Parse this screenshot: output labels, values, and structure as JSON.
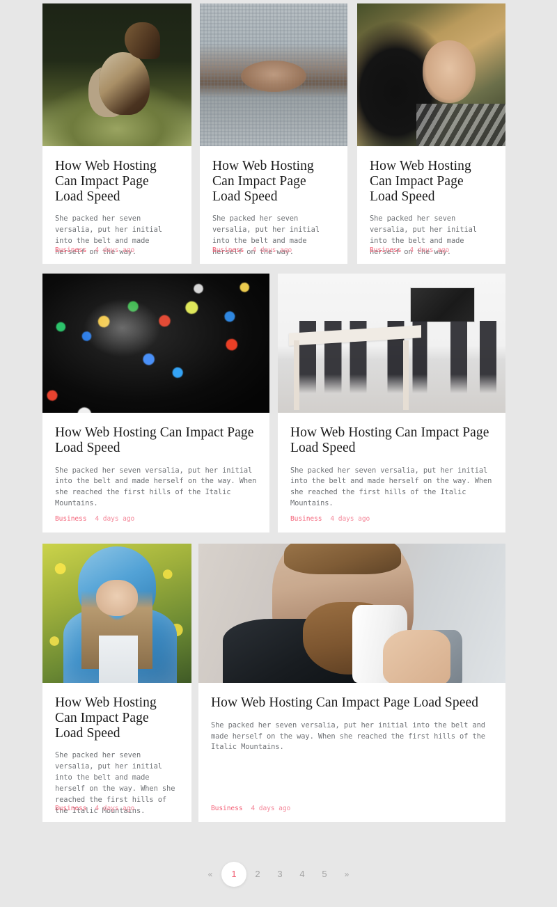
{
  "theme": {
    "page_background": "#e7e7e7",
    "card_background": "#ffffff",
    "accent": "#f4647a",
    "title_color": "#1b1b1b",
    "excerpt_color": "#6f7276",
    "pagination_active_color": "#f05a6e"
  },
  "posts": [
    {
      "id": "post-1",
      "title": "How Web Hosting Can Impact Page Load Speed",
      "excerpt": "She packed her seven versalia, put her initial into the belt and made herself on the way.",
      "category": "Business",
      "date": "4 days ago",
      "image_alt": "elk standing in a green meadow at the edge of a forest"
    },
    {
      "id": "post-2",
      "title": "How Web Hosting Can Impact Page Load Speed",
      "excerpt": "She packed her seven versalia, put her initial into the belt and made herself on the way.",
      "category": "Business",
      "date": "4 days ago",
      "image_alt": "woman peeking out from under a grey waffle blanket"
    },
    {
      "id": "post-3",
      "title": "How Web Hosting Can Impact Page Load Speed",
      "excerpt": "She packed her seven versalia, put her initial into the belt and made herself on the way.",
      "category": "Business",
      "date": "4 days ago",
      "image_alt": "smiling blonde woman lying on moss beside a black dog"
    },
    {
      "id": "post-4",
      "title": "How Web Hosting Can Impact Page Load Speed",
      "excerpt": "She packed her seven versalia, put her initial into the belt and made herself on the way. When she reached the first hills of the Italic Mountains.",
      "category": "Business",
      "date": "4 days ago",
      "image_alt": "close-up of colourful app icons on a smartphone screen"
    },
    {
      "id": "post-5",
      "title": "How Web Hosting Can Impact Page Load Speed",
      "excerpt": "She packed her seven versalia, put her initial into the belt and made herself on the way. When she reached the first hills of the Italic Mountains.",
      "category": "Business",
      "date": "4 days ago",
      "image_alt": "bright white meeting room with wooden table, black chairs and wall-mounted screen"
    },
    {
      "id": "post-6",
      "title": "How Web Hosting Can Impact Page Load Speed",
      "excerpt": "She packed her seven versalia, put her initial into the belt and made herself on the way. When she reached the first hills of the Italic Mountains.",
      "category": "Business",
      "date": "4 days ago",
      "image_alt": "woman in a blue hooded jacket standing among yellow flowers"
    },
    {
      "id": "post-7",
      "title": "How Web Hosting Can Impact Page Load Speed",
      "excerpt": "She packed her seven versalia, put her initial into the belt and made herself on the way. When she reached the first hills of the Italic Mountains.",
      "category": "Business",
      "date": "4 days ago",
      "image_alt": "bearded man drinking from a white takeaway coffee cup"
    }
  ],
  "pagination": {
    "prev": "«",
    "next": "»",
    "pages": [
      "1",
      "2",
      "3",
      "4",
      "5"
    ],
    "current": "1"
  }
}
